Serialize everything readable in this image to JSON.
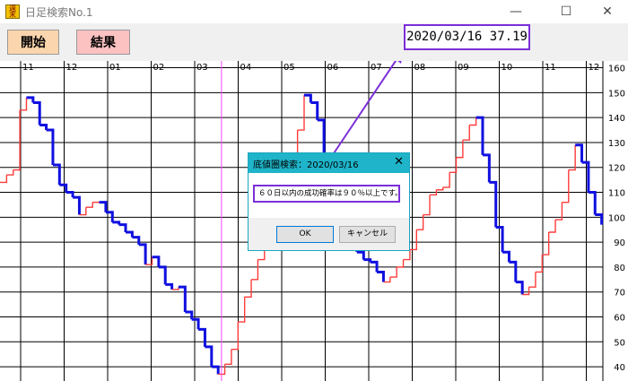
{
  "window": {
    "title": "日足検索No.1",
    "icon_text": "週末",
    "minimize": "—",
    "maximize": "☐",
    "close": "✕"
  },
  "toolbar": {
    "start_label": "開始",
    "result_label": "結果",
    "readout": "2020/03/16 37.19"
  },
  "dialog": {
    "title": "底値圏検索：2020/03/16",
    "close": "✕",
    "message": "６０日以内の成功確率は９０％以上です。",
    "ok_label": "OK",
    "cancel_label": "キャンセル"
  },
  "colors": {
    "rising": "#ff3b3b",
    "falling": "#1010e0",
    "marker": "#ff44ff",
    "annotation": "#7b2fd8"
  },
  "chart_data": {
    "type": "line",
    "x_tick_labels": [
      "11",
      "12",
      "01",
      "02",
      "03",
      "04",
      "05",
      "06",
      "07",
      "08",
      "09",
      "10",
      "11",
      "12"
    ],
    "y_ticks": [
      40,
      50,
      60,
      70,
      80,
      90,
      100,
      110,
      120,
      130,
      140,
      150,
      160
    ],
    "ylim": [
      35,
      162
    ],
    "marker_date": "2020/03/16",
    "marker_value": 37.19,
    "series": [
      {
        "values": [
          114,
          117,
          119,
          143,
          148,
          146,
          137,
          135,
          121,
          113,
          110,
          108,
          101,
          104,
          106,
          106,
          102,
          98,
          97,
          94,
          92,
          89,
          81,
          84,
          80,
          73,
          71,
          72,
          62,
          59,
          55,
          48,
          40,
          37,
          41,
          47,
          58,
          68,
          75,
          83,
          87,
          95,
          95,
          103,
          113,
          135,
          149,
          146,
          139,
          121,
          114,
          98,
          96,
          90,
          86,
          83,
          82,
          78,
          74,
          76,
          80,
          83,
          87,
          95,
          101,
          109,
          111,
          112,
          118,
          124,
          131,
          137,
          140,
          125,
          114,
          96,
          86,
          82,
          74,
          69,
          72,
          78,
          85,
          94,
          99,
          106,
          119,
          129,
          122,
          110,
          101,
          97
        ]
      }
    ]
  }
}
